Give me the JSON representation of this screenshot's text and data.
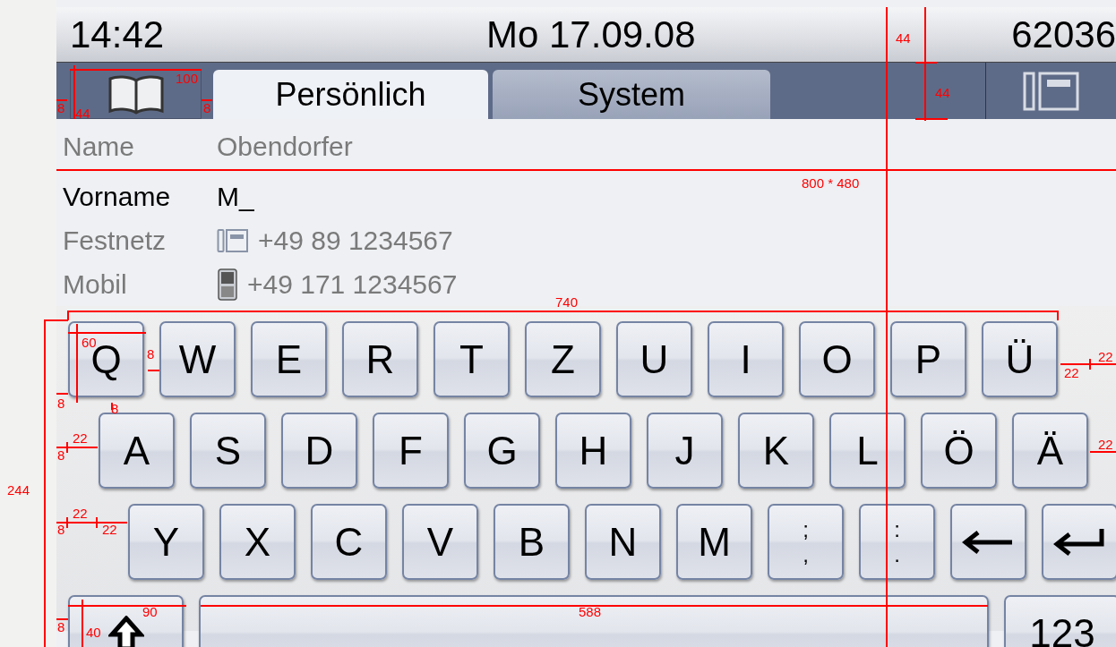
{
  "status_bar": {
    "time": "14:42",
    "date": "Mo 17.09.08",
    "number": "62036"
  },
  "tabs": [
    {
      "label": "Persönlich",
      "selected": true
    },
    {
      "label": "System",
      "selected": false
    }
  ],
  "fields": [
    {
      "label": "Name",
      "value": "Obendorfer",
      "selected": false
    },
    {
      "label": "Vorname",
      "value": "M_",
      "selected": true
    },
    {
      "label": "Festnetz",
      "value": "+49 89 1234567",
      "selected": false,
      "kind": "landline"
    },
    {
      "label": "Mobil",
      "value": "+49 171 1234567",
      "selected": false,
      "kind": "mobile"
    }
  ],
  "keyboard": [
    [
      {
        "label": "Q"
      },
      {
        "label": "W"
      },
      {
        "label": "E"
      },
      {
        "label": "R"
      },
      {
        "label": "T"
      },
      {
        "label": "Z"
      },
      {
        "label": "U"
      },
      {
        "label": "I"
      },
      {
        "label": "O"
      },
      {
        "label": "P"
      },
      {
        "label": "Ü"
      }
    ],
    [
      {
        "label": "A"
      },
      {
        "label": "S"
      },
      {
        "label": "D"
      },
      {
        "label": "F"
      },
      {
        "label": "G"
      },
      {
        "label": "H"
      },
      {
        "label": "J"
      },
      {
        "label": "K"
      },
      {
        "label": "L"
      },
      {
        "label": "Ö"
      },
      {
        "label": "Ä"
      }
    ],
    [
      {
        "label": "Y"
      },
      {
        "label": "X"
      },
      {
        "label": "C"
      },
      {
        "label": "V"
      },
      {
        "label": "B"
      },
      {
        "label": "N"
      },
      {
        "label": "M"
      },
      {
        "kind": "dual",
        "top": ";",
        "bottom": ","
      },
      {
        "kind": "dual",
        "top": ":",
        "bottom": "."
      },
      {
        "kind": "backspace"
      },
      {
        "kind": "enter"
      }
    ],
    [
      {
        "kind": "shift"
      },
      {
        "kind": "space"
      },
      {
        "label": "123"
      }
    ]
  ],
  "annotations": [
    "100",
    "8",
    "44",
    "8",
    "44",
    "44",
    "800 * 480",
    "740",
    "60",
    "8",
    "8",
    "8",
    "22",
    "8",
    "22",
    "22",
    "8",
    "244",
    "22",
    "22",
    "22",
    "90",
    "8",
    "40",
    "588"
  ]
}
